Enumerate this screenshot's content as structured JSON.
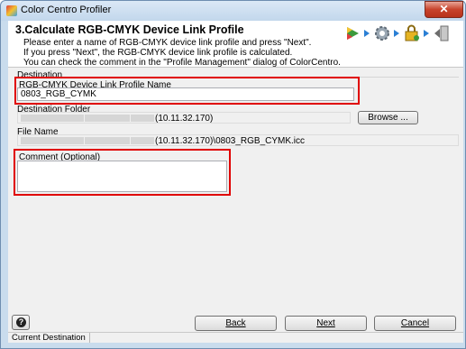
{
  "window": {
    "title": "Color Centro Profiler",
    "close_label": "✕"
  },
  "header": {
    "step_title": "3.Calculate RGB-CMYK Device Link Profile",
    "line1": "Please enter a name of RGB-CMYK device link profile and press \"Next\".",
    "line2": "If you press \"Next\", the RGB-CMYK device link profile is calculated.",
    "line3": "You can check the comment in the \"Profile Management\" dialog of ColorCentro.",
    "step_icons": [
      "play-icon",
      "gear-icon",
      "lock-icon",
      "export-icon"
    ]
  },
  "destination": {
    "group_label": "Destination",
    "profile_name_label": "RGB-CMYK Device Link Profile Name",
    "profile_name_value": "0803_RGB_CYMK",
    "folder_label": "Destination Folder",
    "folder_value": "(10.11.32.170)",
    "browse_label": "Browse ...",
    "file_name_label": "File Name",
    "file_name_value": "(10.11.32.170)\\0803_RGB_CYMK.icc",
    "comment_label": "Comment (Optional)",
    "comment_value": ""
  },
  "footer": {
    "help_label": "?",
    "back_label": "Back",
    "next_label": "Next",
    "cancel_label": "Cancel"
  },
  "status": {
    "text": "Current Destination"
  },
  "colors": {
    "highlight": "#e00000",
    "title_bar": "#c2d7ec",
    "close_button": "#c7432c"
  }
}
